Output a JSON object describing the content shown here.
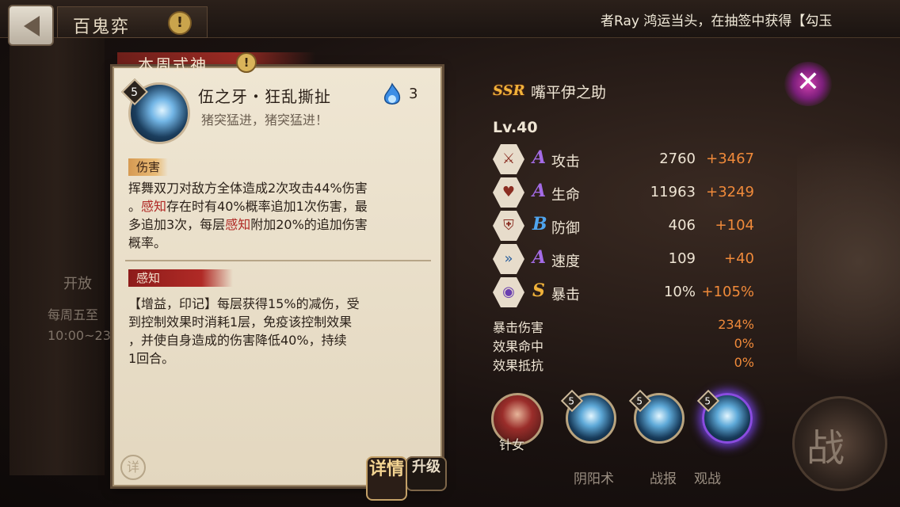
{
  "topbar": {
    "title": "百鬼弈",
    "warn": "!",
    "marquee": "者Ray 鸿运当头，在抽签中获得【勾玉"
  },
  "behind": {
    "line1": "开放",
    "line2": "每周五至",
    "line3": "10:00~23"
  },
  "card": {
    "header": "本周式神",
    "header_warn": "!",
    "level": "5",
    "skill_name": "伍之牙・狂乱撕扯",
    "skill_quote": "猪突猛进，猪突猛进！",
    "orb_cost": "3",
    "tag_damage": "伤害",
    "damage_text_1": "挥舞双刀对敌方全体造成2次攻击44%伤害",
    "damage_text_2a": "。",
    "damage_kw_1": "感知",
    "damage_text_2b": "存在时有40%概率追加1次伤害，最",
    "damage_text_3a": "多追加3次，每层",
    "damage_kw_2": "感知",
    "damage_text_3b": "附加20%的追加伤害",
    "damage_text_4": "概率。",
    "tag_sense": "感知",
    "sense_text_1": "【增益，印记】每层获得15%的减伤，受",
    "sense_text_2": "到控制效果时消耗1层，免疫该控制效果",
    "sense_text_3": "，并使自身造成的伤害降低40%，持续",
    "sense_text_4": "1回合。",
    "detail_small": "详"
  },
  "tabs": {
    "detail": "详情",
    "upgrade": "升级",
    "label_yinyang": "阴阳术",
    "label_battle_report": "战报",
    "label_spectate": "观战"
  },
  "shiki": {
    "rarity": "SSR",
    "name": "嘴平伊之助",
    "level": "Lv.40",
    "stats": [
      {
        "icon": "attack-icon",
        "grade": "A",
        "label": "攻击",
        "value": "2760",
        "add": "+3467"
      },
      {
        "icon": "hp-icon",
        "grade": "A",
        "label": "生命",
        "value": "11963",
        "add": "+3249"
      },
      {
        "icon": "defense-icon",
        "grade": "B",
        "label": "防御",
        "value": "406",
        "add": "+104"
      },
      {
        "icon": "speed-icon",
        "grade": "A",
        "label": "速度",
        "value": "109",
        "add": "+40"
      },
      {
        "icon": "crit-icon",
        "grade": "S",
        "label": "暴击",
        "value": "10%",
        "add": "+105%"
      }
    ],
    "sub_stats": [
      {
        "label": "暴击伤害",
        "value": "234%"
      },
      {
        "label": "效果命中",
        "value": "0%"
      },
      {
        "label": "效果抵抗",
        "value": "0%"
      }
    ],
    "partner_name": "针女",
    "skill_levels": [
      "5",
      "5",
      "5"
    ]
  },
  "battle": "战",
  "colors": {
    "accent_orange": "#f08a3a",
    "grade_a": "#a46be6",
    "grade_b": "#4fa5f0",
    "grade_s": "#f0b23a",
    "highlight_red": "#b02a26"
  }
}
